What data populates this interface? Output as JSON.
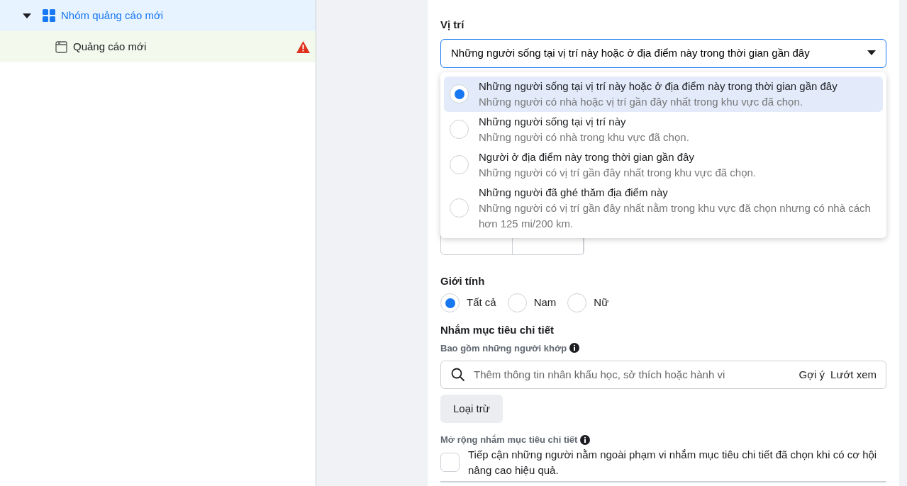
{
  "sidebar": {
    "items": [
      {
        "label": "Nhóm quảng cáo mới",
        "kind": "group",
        "expanded": true,
        "selected": true,
        "warning": false
      },
      {
        "label": "Quảng cáo mới",
        "kind": "ad",
        "selected": false,
        "warning": true
      }
    ]
  },
  "location": {
    "label": "Vị trí",
    "value": "Những người sống tại vị trí này hoặc ở địa điểm này trong thời gian gần đây",
    "expanded": true,
    "options": [
      {
        "title": "Những người sống tại vị trí này hoặc ở địa điểm này trong thời gian gần đây",
        "description": "Những người có nhà hoặc vị trí gần đây nhất trong khu vực đã chọn.",
        "selected": true
      },
      {
        "title": "Những người sống tại vị trí này",
        "description": "Những người có nhà trong khu vực đã chọn.",
        "selected": false
      },
      {
        "title": "Người ở địa điểm này trong thời gian gần đây",
        "description": "Những người có vị trí gần đây nhất trong khu vực đã chọn.",
        "selected": false
      },
      {
        "title": "Những người đã ghé thăm địa điểm này",
        "description": "Những người có vị trí gần đây nhất nằm trong khu vực đã chọn nhưng có nhà cách hơn 125 mi/200 km.",
        "selected": false
      }
    ]
  },
  "gender": {
    "label": "Giới tính",
    "options": [
      {
        "label": "Tất cả",
        "selected": true
      },
      {
        "label": "Nam",
        "selected": false
      },
      {
        "label": "Nữ",
        "selected": false
      }
    ]
  },
  "detailed_targeting": {
    "title": "Nhắm mục tiêu chi tiết",
    "include_label": "Bao gồm những người khớp",
    "search": {
      "placeholder": "Thêm thông tin nhân khẩu học, sở thích hoặc hành vi"
    },
    "links": [
      "Gợi ý",
      "Lướt xem"
    ],
    "exclude_button": "Loại trừ",
    "expansion": {
      "label": "Mở rộng nhắm mục tiêu chi tiết",
      "text": "Tiếp cận những người nằm ngoài phạm vi nhắm mục tiêu chi tiết đã chọn khi có cơ hội nâng cao hiệu quả.",
      "checked": false
    }
  }
}
